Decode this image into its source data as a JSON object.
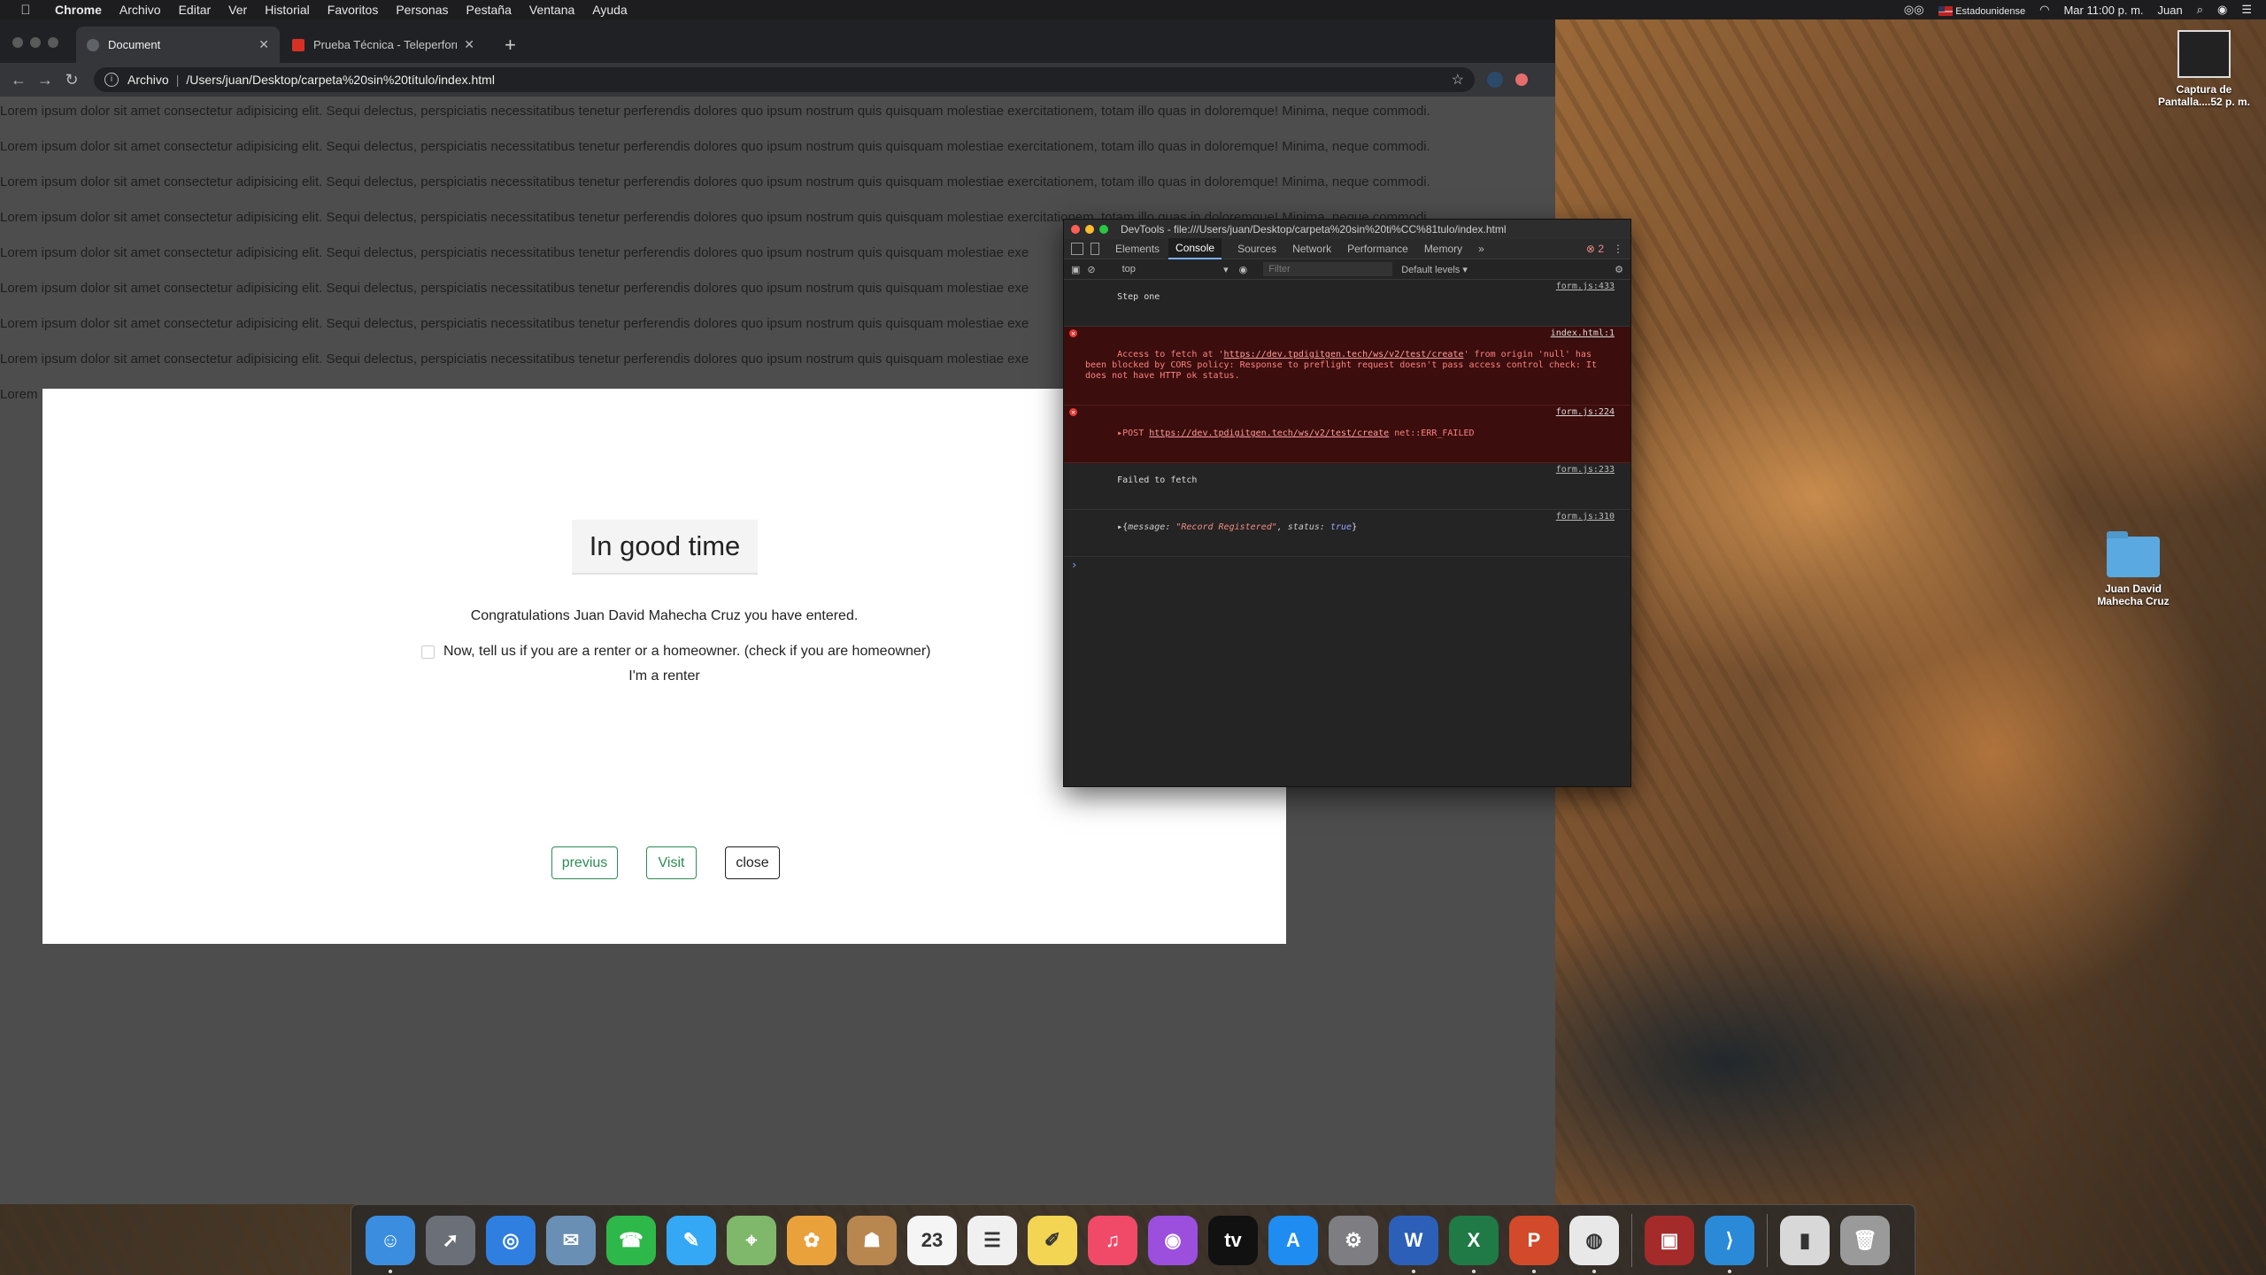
{
  "menubar": {
    "app_name": "Chrome",
    "items": [
      "Archivo",
      "Editar",
      "Ver",
      "Historial",
      "Favoritos",
      "Personas",
      "Pestaña",
      "Ventana",
      "Ayuda"
    ],
    "input_source": "Estadounidense",
    "clock": "Mar 11:00 p. m.",
    "user": "Juan"
  },
  "browser": {
    "tabs": [
      {
        "title": "Document",
        "active": true
      },
      {
        "title": "Prueba Técnica - Teleperformance",
        "active": false
      }
    ],
    "omnibox": {
      "scheme_label": "Archivo",
      "url": "/Users/juan/Desktop/carpeta%20sin%20título/index.html"
    }
  },
  "page": {
    "lorem_lines": [
      "Lorem ipsum dolor sit amet consectetur adipisicing elit. Sequi delectus, perspiciatis necessitatibus tenetur perferendis dolores quo ipsum nostrum quis quisquam molestiae exercitationem, totam illo quas in doloremque! Minima, neque commodi.",
      "Lorem ipsum dolor sit amet consectetur adipisicing elit. Sequi delectus, perspiciatis necessitatibus tenetur perferendis dolores quo ipsum nostrum quis quisquam molestiae exercitationem, totam illo quas in doloremque! Minima, neque commodi.",
      "Lorem ipsum dolor sit amet consectetur adipisicing elit. Sequi delectus, perspiciatis necessitatibus tenetur perferendis dolores quo ipsum nostrum quis quisquam molestiae exercitationem, totam illo quas in doloremque! Minima, neque commodi.",
      "Lorem ipsum dolor sit amet consectetur adipisicing elit. Sequi delectus, perspiciatis necessitatibus tenetur perferendis dolores quo ipsum nostrum quis quisquam molestiae exercitationem, totam illo quas in doloremque! Minima, neque commodi.",
      "Lorem ipsum dolor sit amet consectetur adipisicing elit. Sequi delectus, perspiciatis necessitatibus tenetur perferendis dolores quo ipsum nostrum quis quisquam molestiae exe",
      "Lorem ipsum dolor sit amet consectetur adipisicing elit. Sequi delectus, perspiciatis necessitatibus tenetur perferendis dolores quo ipsum nostrum quis quisquam molestiae exe",
      "Lorem ipsum dolor sit amet consectetur adipisicing elit. Sequi delectus, perspiciatis necessitatibus tenetur perferendis dolores quo ipsum nostrum quis quisquam molestiae exe",
      "Lorem ipsum dolor sit amet consectetur adipisicing elit. Sequi delectus, perspiciatis necessitatibus tenetur perferendis dolores quo ipsum nostrum quis quisquam molestiae exe",
      "Lorem"
    ],
    "modal": {
      "title": "In good time",
      "message": "Congratulations Juan David Mahecha Cruz you have entered.",
      "checkbox_label": "Now, tell us if you are a renter or a homeowner. (check if you are homeowner)",
      "status_text": "I'm a renter",
      "buttons": {
        "previous": "previus",
        "visit": "Visit",
        "close": "close"
      }
    }
  },
  "devtools": {
    "title": "DevTools - file:///Users/juan/Desktop/carpeta%20sin%20ti%CC%81tulo/index.html",
    "tabs": [
      "Elements",
      "Console",
      "Sources",
      "Network",
      "Performance",
      "Memory"
    ],
    "active_tab": "Console",
    "more_tabs": "»",
    "error_count": "2",
    "context": "top",
    "filter_placeholder": "Filter",
    "levels": "Default levels ▾",
    "console": {
      "line1": {
        "text": "Step one",
        "source": "form.js:433"
      },
      "line2": {
        "pre": "Access to fetch at '",
        "url": "https://dev.tpdigitgen.tech/ws/v2/test/create",
        "post": "' from origin 'null' has been blocked by CORS policy: Response to preflight request doesn't pass access control check: It does not have HTTP ok status.",
        "source": "index.html:1"
      },
      "line3": {
        "pre": "▸POST ",
        "url": "https://dev.tpdigitgen.tech/ws/v2/test/create",
        "post": " net::ERR_FAILED",
        "source": "form.js:224"
      },
      "line4": {
        "text": "Failed to fetch",
        "source": "form.js:233"
      },
      "line5": {
        "prefix": "▸{",
        "key1": "message: ",
        "val1": "\"Record Registered\"",
        "key2": ", status: ",
        "val2": "true",
        "suffix": "}",
        "source": "form.js:310"
      },
      "prompt": "›"
    }
  },
  "desktop": {
    "icons": [
      {
        "label": "Captura de Pantalla....52 p. m."
      },
      {
        "label": "Juan David Mahecha  Cruz"
      }
    ]
  },
  "dock": {
    "apps": [
      {
        "name": "finder-icon",
        "color": "#3b8de0",
        "glyph": "☺",
        "running": true
      },
      {
        "name": "launchpad-icon",
        "color": "#6b6f78",
        "glyph": "➚",
        "running": false
      },
      {
        "name": "safari-icon",
        "color": "#2f7fe0",
        "glyph": "◎",
        "running": false
      },
      {
        "name": "preview-icon",
        "color": "#6a8fb5",
        "glyph": "✉",
        "running": false
      },
      {
        "name": "facetime-icon",
        "color": "#2fb84a",
        "glyph": "☎",
        "running": false
      },
      {
        "name": "messages-icon",
        "color": "#34a8f5",
        "glyph": "✎",
        "running": false
      },
      {
        "name": "maps-icon",
        "color": "#7fb86a",
        "glyph": "⌖",
        "running": false
      },
      {
        "name": "photos-icon",
        "color": "#e9a23b",
        "glyph": "✿",
        "running": false
      },
      {
        "name": "contacts-icon",
        "color": "#b8864f",
        "glyph": "☗",
        "running": false
      },
      {
        "name": "calendar-icon",
        "color": "#f5f5f5",
        "glyph": "23",
        "running": false
      },
      {
        "name": "reminders-icon",
        "color": "#f0f0f0",
        "glyph": "☰",
        "running": false
      },
      {
        "name": "notes-icon",
        "color": "#f3d453",
        "glyph": "✐",
        "running": false
      },
      {
        "name": "music-icon",
        "color": "#f04a68",
        "glyph": "♫",
        "running": false
      },
      {
        "name": "podcasts-icon",
        "color": "#9b4fdc",
        "glyph": "◉",
        "running": false
      },
      {
        "name": "tv-icon",
        "color": "#111111",
        "glyph": "tv",
        "running": false
      },
      {
        "name": "app-store-icon",
        "color": "#1e8cf0",
        "glyph": "A",
        "running": false
      },
      {
        "name": "system-preferences-icon",
        "color": "#7d7d82",
        "glyph": "⚙",
        "running": false
      },
      {
        "name": "word-icon",
        "color": "#2b5fb8",
        "glyph": "W",
        "running": true
      },
      {
        "name": "excel-icon",
        "color": "#1f7a45",
        "glyph": "X",
        "running": true
      },
      {
        "name": "powerpoint-icon",
        "color": "#d24a2a",
        "glyph": "P",
        "running": true
      },
      {
        "name": "chrome-icon",
        "color": "#e8e8e8",
        "glyph": "◍",
        "running": true
      },
      {
        "name": "photo-booth-icon",
        "color": "#a52a2a",
        "glyph": "▣",
        "running": false
      },
      {
        "name": "vscode-icon",
        "color": "#2a8ad8",
        "glyph": "⟩",
        "running": true
      },
      {
        "name": "archive-utility-icon",
        "color": "#d8d8d8",
        "glyph": "▮",
        "running": false
      },
      {
        "name": "trash-icon",
        "color": "#9a9a9a",
        "glyph": "🗑",
        "running": false
      }
    ]
  }
}
